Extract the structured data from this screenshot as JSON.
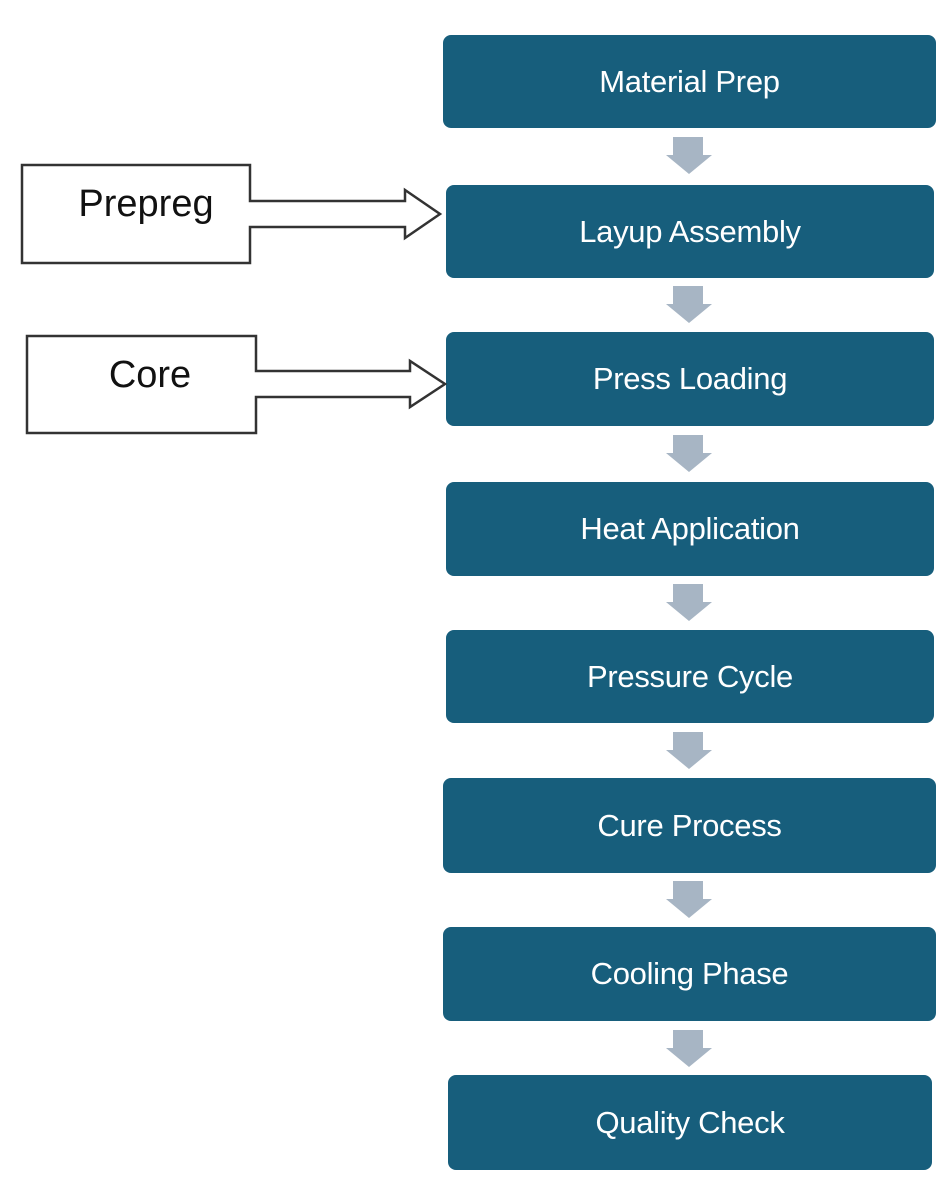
{
  "colors": {
    "step_fill": "#175e7c",
    "step_text": "#ffffff",
    "connector": "#a7b5c4",
    "input_stroke": "#333333"
  },
  "steps": [
    {
      "label": "Material Prep"
    },
    {
      "label": "Layup Assembly"
    },
    {
      "label": "Press Loading"
    },
    {
      "label": "Heat Application"
    },
    {
      "label": "Pressure Cycle"
    },
    {
      "label": "Cure Process"
    },
    {
      "label": "Cooling Phase"
    },
    {
      "label": "Quality Check"
    }
  ],
  "inputs": [
    {
      "label": "Prepreg",
      "target": "Layup Assembly"
    },
    {
      "label": "Core",
      "target": "Press Loading"
    }
  ]
}
